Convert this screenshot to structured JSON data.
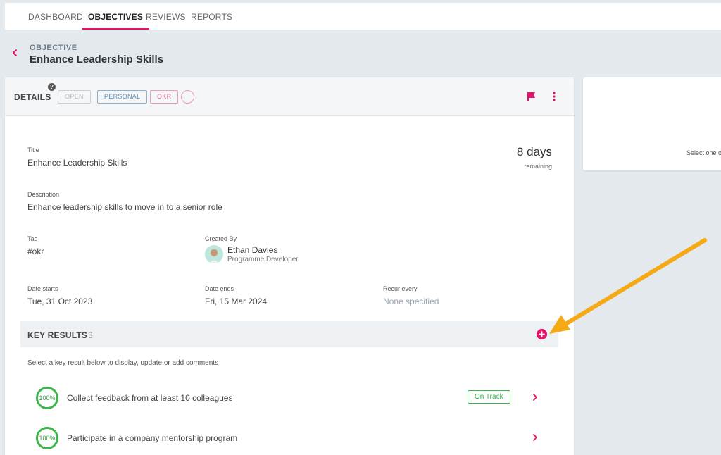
{
  "nav": {
    "tabs": [
      {
        "label": "DASHBOARD"
      },
      {
        "label": "OBJECTIVES"
      },
      {
        "label": "REVIEWS"
      },
      {
        "label": "REPORTS"
      }
    ]
  },
  "header": {
    "kicker": "OBJECTIVE",
    "title": "Enhance Leadership Skills"
  },
  "details": {
    "label": "DETAILS",
    "help_glyph": "?",
    "chips": {
      "open": "OPEN",
      "personal": "PERSONAL",
      "okr": "OKR"
    },
    "remaining_value": "8 days",
    "remaining_label": "remaining",
    "title_label": "Title",
    "title_value": "Enhance Leadership Skills",
    "description_label": "Description",
    "description_value": "Enhance leadership skills to move in to a senior role",
    "tag_label": "Tag",
    "tag_value": "#okr",
    "created_by_label": "Created By",
    "creator_name": "Ethan Davies",
    "creator_role": "Programme Developer",
    "date_starts_label": "Date starts",
    "date_starts_value": "Tue, 31 Oct 2023",
    "date_ends_label": "Date ends",
    "date_ends_value": "Fri, 15 Mar 2024",
    "recur_label": "Recur every",
    "recur_value": "None specified"
  },
  "key_results": {
    "title": "KEY RESULTS",
    "count": "3",
    "hint": "Select a key result below to display, update or add comments",
    "items": [
      {
        "progress": "100%",
        "text": "Collect feedback from at least 10 colleagues",
        "status": "On Track"
      },
      {
        "progress": "100%",
        "text": "Participate in a company mentorship program",
        "status": ""
      }
    ]
  },
  "side_panel": {
    "text": "Select one o"
  },
  "colors": {
    "accent": "#e5146b",
    "success": "#3cb54a",
    "annotation_arrow": "#f4a915"
  }
}
